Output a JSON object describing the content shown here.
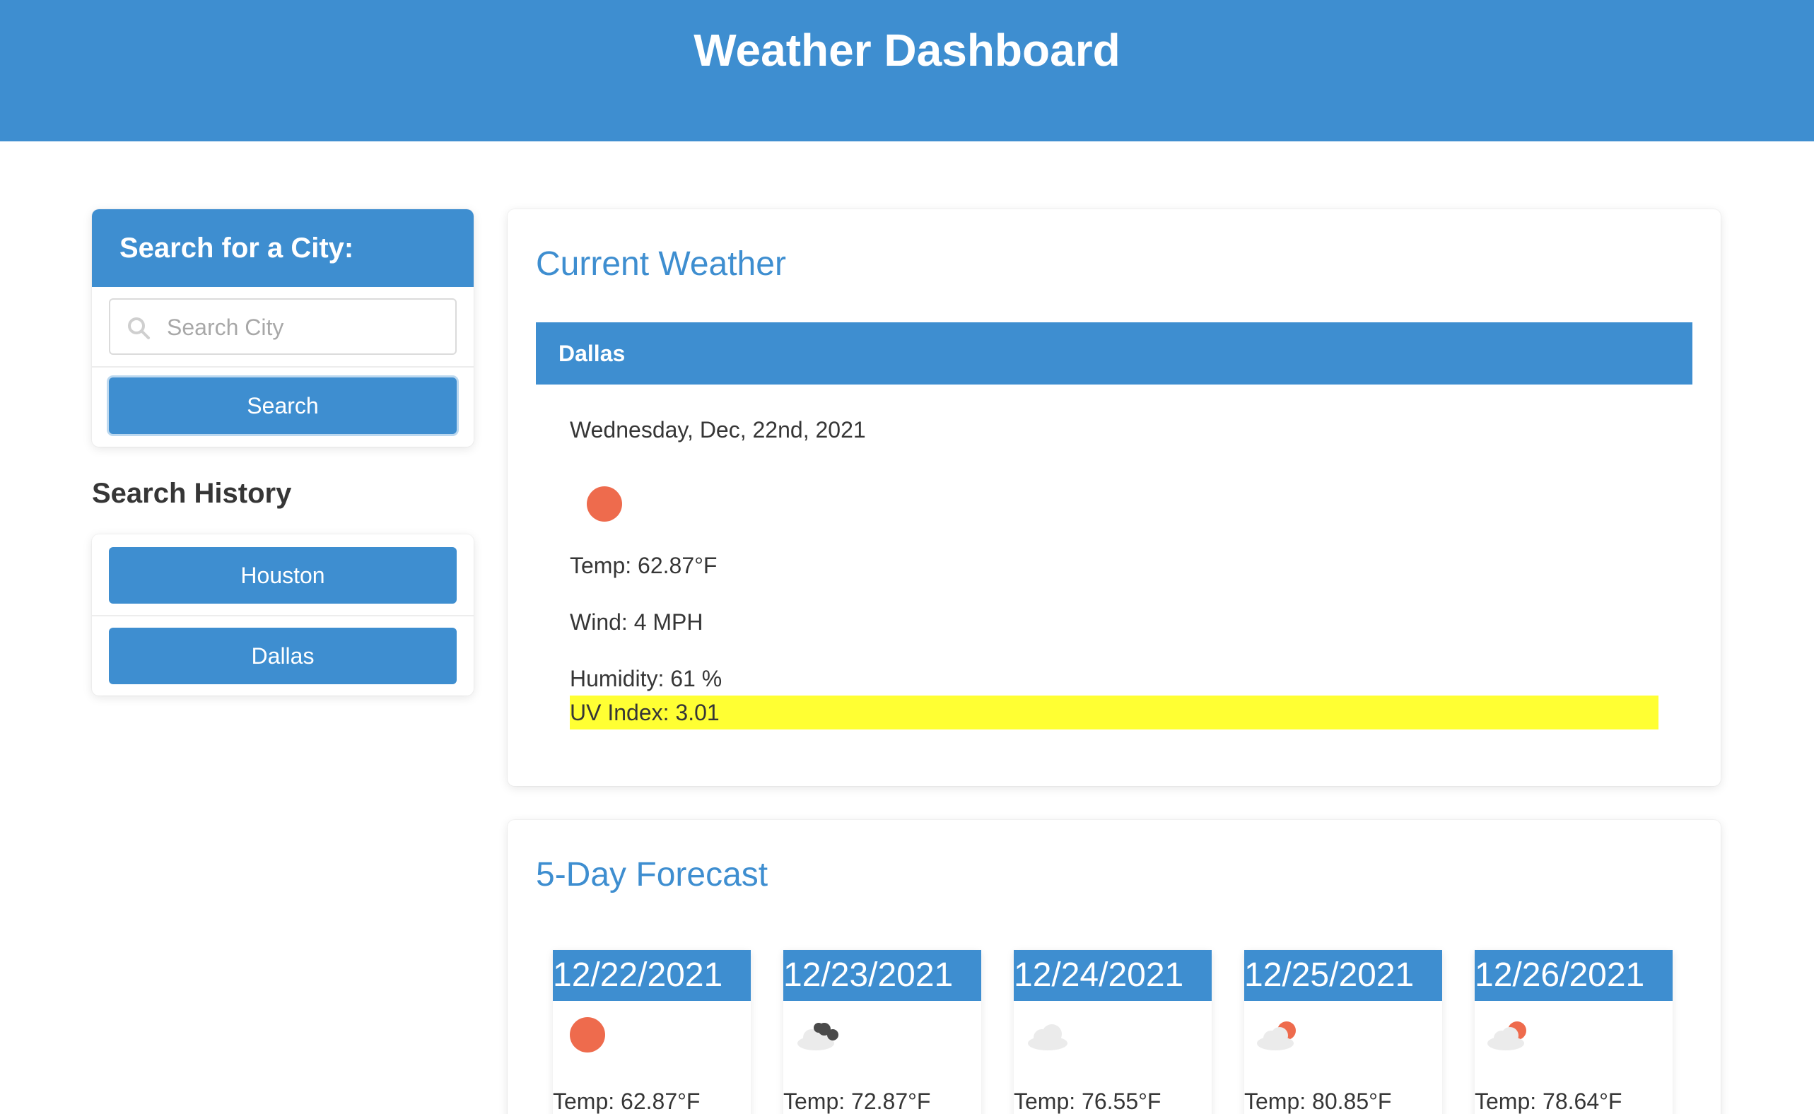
{
  "header": {
    "title": "Weather Dashboard"
  },
  "search": {
    "heading": "Search for a City:",
    "placeholder": "Search City",
    "value": "",
    "button_label": "Search"
  },
  "history": {
    "title": "Search History",
    "items": [
      {
        "label": "Houston"
      },
      {
        "label": "Dallas"
      }
    ]
  },
  "current": {
    "title": "Current Weather",
    "city": "Dallas",
    "date": "Wednesday, Dec, 22nd, 2021",
    "icon": "sun-icon",
    "temp": "Temp: 62.87°F",
    "wind": "Wind: 4 MPH",
    "humidity": "Humidity: 61 %",
    "uv": "UV Index: 3.01",
    "uv_color": "#ffff33"
  },
  "forecast": {
    "title": "5-Day Forecast",
    "days": [
      {
        "date": "12/22/2021",
        "icon": "sun-icon",
        "temp": "Temp: 62.87°F"
      },
      {
        "date": "12/23/2021",
        "icon": "broken-clouds-icon",
        "temp": "Temp: 72.87°F"
      },
      {
        "date": "12/24/2021",
        "icon": "cloud-icon",
        "temp": "Temp: 76.55°F"
      },
      {
        "date": "12/25/2021",
        "icon": "partly-cloudy-icon",
        "temp": "Temp: 80.85°F"
      },
      {
        "date": "12/26/2021",
        "icon": "partly-cloudy-icon",
        "temp": "Temp: 78.64°F"
      }
    ]
  },
  "colors": {
    "primary": "#3e8ed0",
    "sun": "#ee6b4d",
    "uv_highlight": "#ffff33"
  }
}
